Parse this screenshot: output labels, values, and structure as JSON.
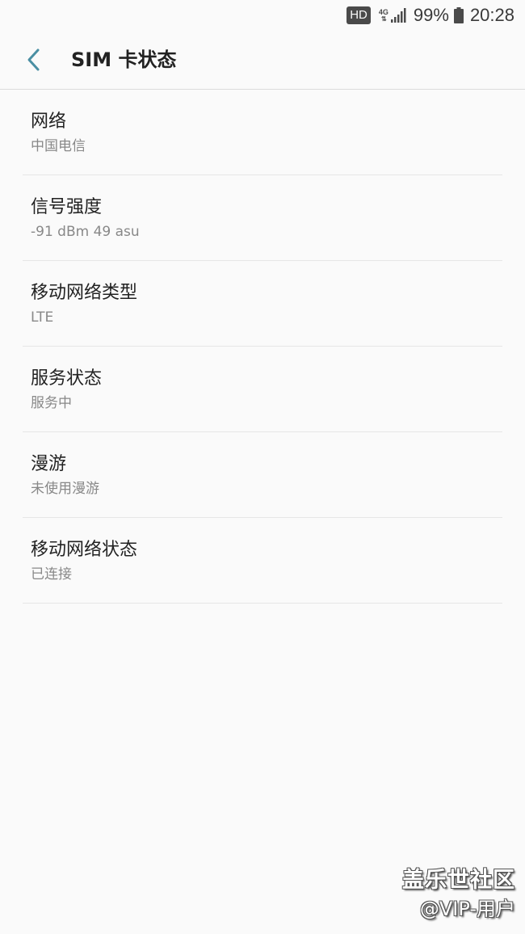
{
  "status_bar": {
    "hd_label": "HD",
    "network_label": "4G",
    "battery_percent": "99%",
    "battery_level": 0.99,
    "time": "20:28",
    "icons": [
      "signal-icon",
      "battery-icon"
    ]
  },
  "app_bar": {
    "title": "SIM 卡状态",
    "back_icon": "chevron-left-icon",
    "accent_color": "#4a8fa3"
  },
  "items": [
    {
      "title": "网络",
      "value": "中国电信"
    },
    {
      "title": "信号强度",
      "value": "-91 dBm 49 asu"
    },
    {
      "title": "移动网络类型",
      "value": "LTE"
    },
    {
      "title": "服务状态",
      "value": "服务中"
    },
    {
      "title": "漫游",
      "value": "未使用漫游"
    },
    {
      "title": "移动网络状态",
      "value": "已连接"
    }
  ],
  "watermark": {
    "line1": "盖乐世社区",
    "line2": "@VIP-用户"
  }
}
